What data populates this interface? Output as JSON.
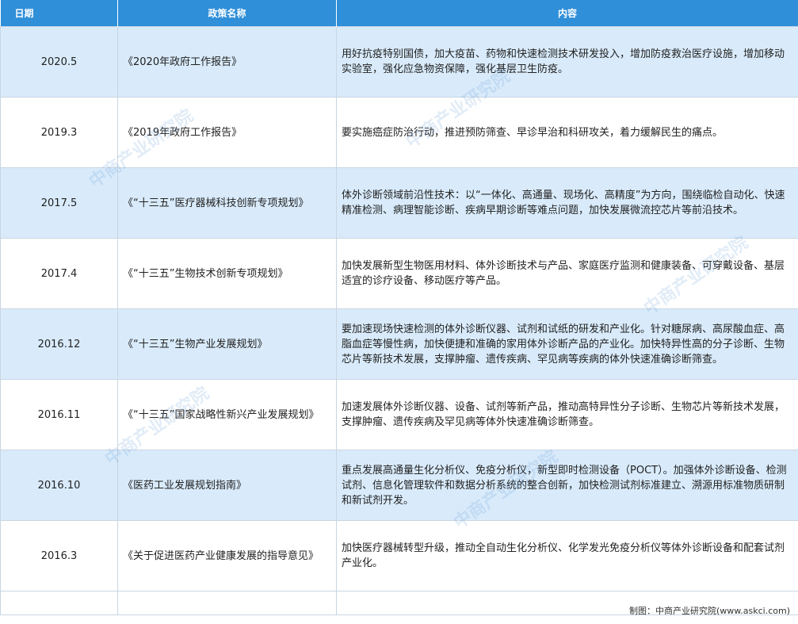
{
  "headers": [
    "日期",
    "政策名称",
    "内容"
  ],
  "rows": [
    {
      "date": "2020.5",
      "name": "《2020年政府工作报告》",
      "content": "用好抗疫特别国债，加大疫苗、药物和快速检测技术研发投入，增加防疫救治医疗设施，增加移动实验室，强化应急物资保障，强化基层卫生防疫。"
    },
    {
      "date": "2019.3",
      "name": "《2019年政府工作报告》",
      "content": "要实施癌症防治行动，推进预防筛查、早诊早治和科研攻关，着力缓解民生的痛点。"
    },
    {
      "date": "2017.5",
      "name": "《“十三五”医疗器械科技创新专项规划》",
      "content": "体外诊断领域前沿性技术：以“一体化、高通量、现场化、高精度”为方向，围绕临检自动化、快速精准检测、病理智能诊断、疾病早期诊断等难点问题，加快发展微流控芯片等前沿技术。"
    },
    {
      "date": "2017.4",
      "name": "《“十三五”生物技术创新专项规划》",
      "content": "加快发展新型生物医用材料、体外诊断技术与产品、家庭医疗监测和健康装备、可穿戴设备、基层适宜的诊疗设备、移动医疗等产品。"
    },
    {
      "date": "2016.12",
      "name": "《“十三五”生物产业发展规划》",
      "content": "要加速现场快速检测的体外诊断仪器、试剂和试纸的研发和产业化。针对糖尿病、高尿酸血症、高脂血症等慢性病，加快便捷和准确的家用体外诊断产品的产业化。加快特异性高的分子诊断、生物芯片等新技术发展，支撑肿瘤、遗传疾病、罕见病等疾病的体外快速准确诊断筛查。"
    },
    {
      "date": "2016.11",
      "name": "《“十三五”国家战略性新兴产业发展规划》",
      "content": "加速发展体外诊断仪器、设备、试剂等新产品，推动高特异性分子诊断、生物芯片等新技术发展，支撑肿瘤、遗传疾病及罕见病等体外快速准确诊断筛查。"
    },
    {
      "date": "2016.10",
      "name": "《医药工业发展规划指南》",
      "content": "重点发展高通量生化分析仪、免疫分析仪，新型即时检测设备（POCT）。加强体外诊断设备、检测试剂、信息化管理软件和数据分析系统的整合创新，加快检测试剂标准建立、溯源用标准物质研制和新试剂开发。"
    },
    {
      "date": "2016.3",
      "name": "《关于促进医药产业健康发展的指导意见》",
      "content": "加快医疗器械转型升级，推动全自动生化分析仪、化学发光免疫分析仪等体外诊断设备和配套试剂产业化。"
    }
  ],
  "footer": "制图：中商产业研究院(www.askci.com)",
  "watermark": "中商产业研究院"
}
